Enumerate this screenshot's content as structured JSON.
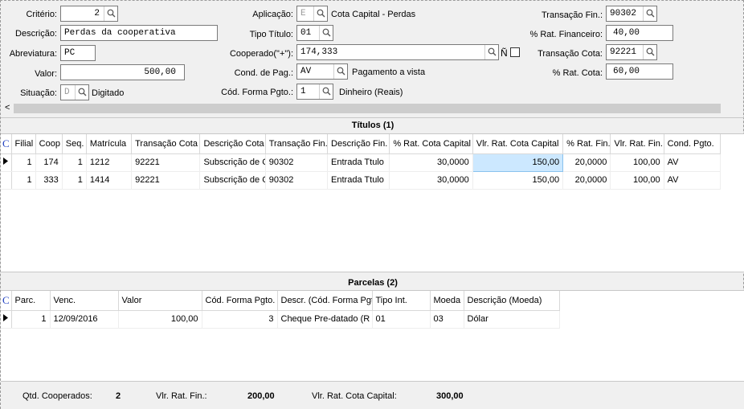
{
  "form": {
    "criterio": {
      "label": "Critério:",
      "value": "2"
    },
    "descricao": {
      "label": "Descrição:",
      "value": "Perdas da cooperativa"
    },
    "abreviatura": {
      "label": "Abreviatura:",
      "value": "PC"
    },
    "valor": {
      "label": "Valor:",
      "value": "500,00"
    },
    "situacao": {
      "label": "Situação:",
      "value": "D",
      "desc": "Digitado"
    },
    "aplicacao": {
      "label": "Aplicação:",
      "value": "E",
      "desc": "Cota Capital - Perdas"
    },
    "tipo_titulo": {
      "label": "Tipo Título:",
      "value": "01"
    },
    "cooperado": {
      "label": "Cooperado(\"+\"):",
      "value": "174,333",
      "flag": "Ñ"
    },
    "cond_pag": {
      "label": "Cond. de Pag.:",
      "value": "AV",
      "desc": "Pagamento a vista"
    },
    "cod_forma_pgto": {
      "label": "Cód. Forma Pgto.:",
      "value": "1",
      "desc": "Dinheiro (Reais)"
    },
    "transacao_fin": {
      "label": "Transação Fin.:",
      "value": "90302"
    },
    "rat_financeiro": {
      "label": "% Rat. Financeiro:",
      "value": "40,00"
    },
    "transacao_cota": {
      "label": "Transação Cota:",
      "value": "92221"
    },
    "rat_cota": {
      "label": "% Rat. Cota:",
      "value": "60,00"
    }
  },
  "scroll_left": "<",
  "titulos": {
    "title": "Títulos (1)",
    "corner": "C",
    "columns": [
      "Filial",
      "Coop",
      "Seq.",
      "Matrícula",
      "Transação Cota",
      "Descrição Cota",
      "Transação Fin.",
      "Descrição Fin.",
      "% Rat. Cota Capital",
      "Vlr. Rat. Cota Capital",
      "% Rat. Fin.",
      "Vlr. Rat. Fin.",
      "Cond. Pgto."
    ],
    "rows": [
      [
        "1",
        "174",
        "1",
        "1212",
        "92221",
        "Subscrição de C",
        "90302",
        "Entrada Ttulo",
        "30,0000",
        "150,00",
        "20,0000",
        "100,00",
        "AV"
      ],
      [
        "1",
        "333",
        "1",
        "1414",
        "92221",
        "Subscrição de C",
        "90302",
        "Entrada Ttulo",
        "30,0000",
        "150,00",
        "20,0000",
        "100,00",
        "AV"
      ]
    ]
  },
  "parcelas": {
    "title": "Parcelas (2)",
    "corner": "C",
    "columns": [
      "Parc.",
      "Venc.",
      "Valor",
      "Cód. Forma Pgto.",
      "Descr. (Cód. Forma Pgto.)",
      "Tipo Int.",
      "Moeda",
      "Descrição (Moeda)"
    ],
    "rows": [
      [
        "1",
        "12/09/2016",
        "100,00",
        "3",
        "Cheque Pre-datado (R",
        "01",
        "03",
        "Dólar"
      ]
    ]
  },
  "footer": {
    "qtd_label": "Qtd. Cooperados:",
    "qtd_value": "2",
    "rat_fin_label": "Vlr. Rat. Fin.:",
    "rat_fin_value": "200,00",
    "rat_cota_label": "Vlr. Rat. Cota Capital:",
    "rat_cota_value": "300,00"
  }
}
